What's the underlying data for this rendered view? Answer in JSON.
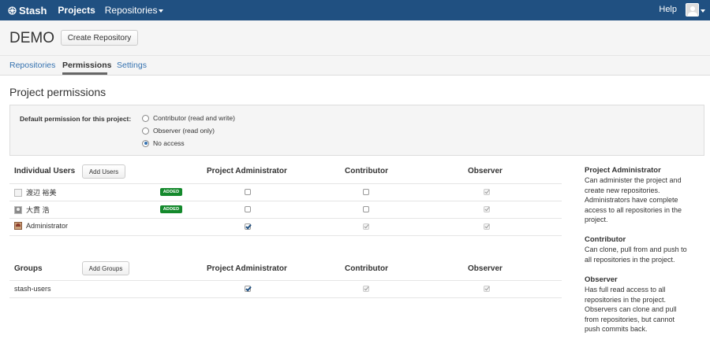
{
  "topbar": {
    "logo": "Stash",
    "projects": "Projects",
    "repositories": "Repositories",
    "help": "Help"
  },
  "header": {
    "project_name": "DEMO",
    "create_repo": "Create Repository"
  },
  "tabs": [
    {
      "label": "Repositories"
    },
    {
      "label": "Permissions"
    },
    {
      "label": "Settings"
    }
  ],
  "section_title": "Project permissions",
  "default_permission": {
    "label": "Default permission for this project:",
    "options": [
      {
        "label": "Contributor (read and write)"
      },
      {
        "label": "Observer (read only)"
      },
      {
        "label": "No access"
      }
    ],
    "selected": "No access"
  },
  "users_table": {
    "heading": "Individual Users",
    "add_button": "Add Users",
    "columns": [
      "Project Administrator",
      "Contributor",
      "Observer"
    ],
    "rows": [
      {
        "name": "渡辺 裕美",
        "badge": "ADDED",
        "admin": false,
        "contributor": false,
        "observer": true
      },
      {
        "name": "大貫 浩",
        "badge": "ADDED",
        "admin": false,
        "contributor": false,
        "observer": true
      },
      {
        "name": "Administrator",
        "badge": "",
        "admin": true,
        "contributor": true,
        "observer": true
      }
    ]
  },
  "groups_table": {
    "heading": "Groups",
    "add_button": "Add Groups",
    "columns": [
      "Project Administrator",
      "Contributor",
      "Observer"
    ],
    "rows": [
      {
        "name": "stash-users",
        "admin": true,
        "contributor": true,
        "observer": true
      }
    ]
  },
  "descriptions": [
    {
      "title": "Project Administrator",
      "lines": [
        "Can administer the project and",
        "create new repositories.",
        "Administrators have complete",
        "access to all repositories in the",
        "project."
      ]
    },
    {
      "title": "Contributor",
      "lines": [
        "Can clone, pull from and push to",
        "all repositories in the project."
      ]
    },
    {
      "title": "Observer",
      "lines": [
        "Has full read access to all",
        "repositories in the project.",
        "Observers can clone and pull",
        "from repositories, but cannot",
        "push commits back."
      ]
    }
  ],
  "colors": {
    "topbar": "#205081",
    "link": "#3572b0",
    "badge": "#14892c"
  }
}
